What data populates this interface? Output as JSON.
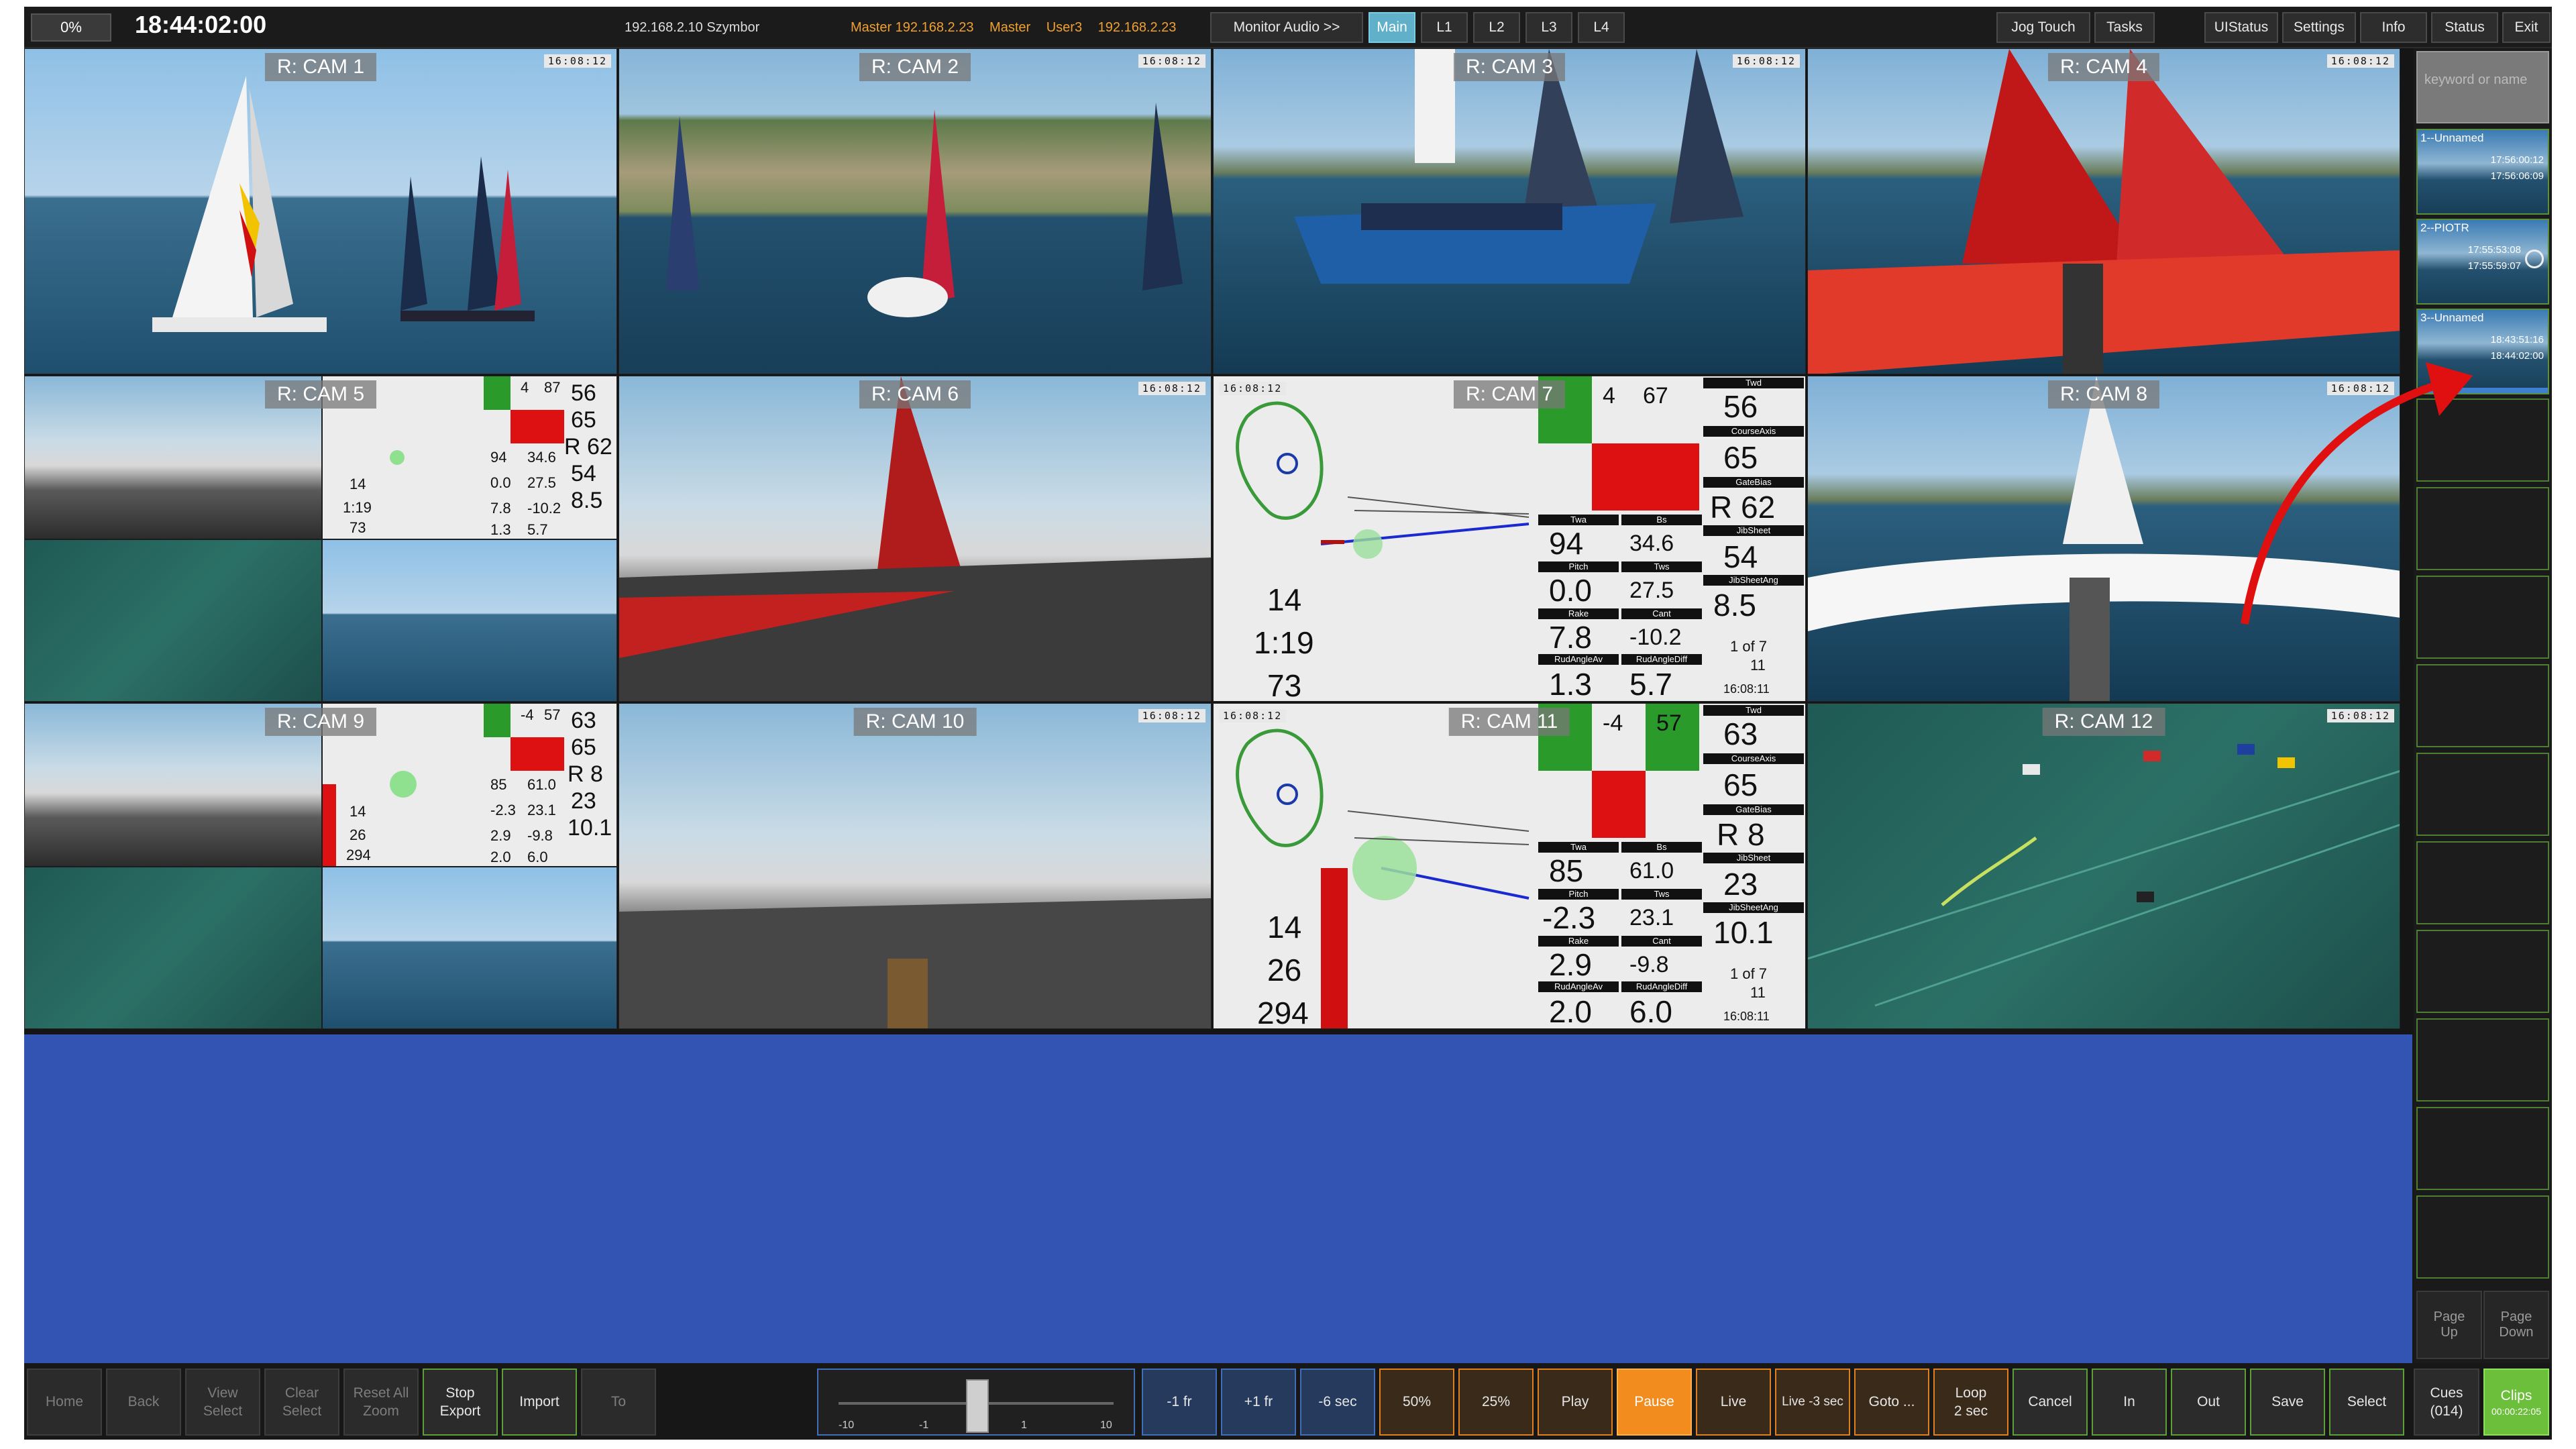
{
  "topbar": {
    "percent": "0%",
    "clock": "18:44:02:00",
    "ip": "192.168.2.10 Szymbor",
    "master_parts": [
      "Master 192.168.2.23",
      "Master",
      "User3",
      "192.168.2.23"
    ],
    "buttons": {
      "monitor_audio": "Monitor Audio >>",
      "main": "Main",
      "l1": "L1",
      "l2": "L2",
      "l3": "L3",
      "l4": "L4",
      "jog_touch": "Jog Touch",
      "tasks": "Tasks",
      "uistatus": "UIStatus",
      "settings": "Settings",
      "info": "Info",
      "status": "Status",
      "exit": "Exit"
    }
  },
  "cameras": [
    {
      "label": "R: CAM 1",
      "tc": "16:08:12"
    },
    {
      "label": "R: CAM 2",
      "tc": "16:08:12"
    },
    {
      "label": "R: CAM 3",
      "tc": "16:08:12"
    },
    {
      "label": "R: CAM 4",
      "tc": "16:08:12"
    },
    {
      "label": "R: CAM 5",
      "tc": ""
    },
    {
      "label": "R: CAM 6",
      "tc": "16:08:12"
    },
    {
      "label": "R: CAM 7",
      "tc": "16:08:12"
    },
    {
      "label": "R: CAM 8",
      "tc": "16:08:12"
    },
    {
      "label": "R: CAM 9",
      "tc": ""
    },
    {
      "label": "R: CAM 10",
      "tc": "16:08:12"
    },
    {
      "label": "R: CAM 11",
      "tc": "16:08:12"
    },
    {
      "label": "R: CAM 12",
      "tc": "16:08:12"
    }
  ],
  "cam7": {
    "top": [
      "4",
      "67"
    ],
    "twd_lbl": "Twd",
    "twd": "56",
    "courseaxis_lbl": "CourseAxis",
    "courseaxis": "65",
    "gatebias_lbl": "GateBias",
    "gatebias": "R 62",
    "jibsheet_lbl": "JibSheet",
    "jibsheet": "54",
    "jibsheetang_lbl": "JibSheetAng",
    "jibsheetang": "8.5",
    "twa_lbl": "Twa",
    "twa": "94",
    "bs_lbl": "Bs",
    "bs": "34.6",
    "pitch_lbl": "Pitch",
    "pitch": "0.0",
    "tws_lbl": "Tws",
    "tws": "27.5",
    "rake_lbl": "Rake",
    "rake": "7.8",
    "cant_lbl": "Cant",
    "cant": "-10.2",
    "rudav_lbl": "RudAngleAv",
    "rudav": "1.3",
    "ruddiff_lbl": "RudAngleDiff",
    "ruddiff": "5.7",
    "legof": "1 of 7",
    "leg": "11",
    "time": "16:08:11",
    "left": [
      "14",
      "1:19",
      "73"
    ]
  },
  "cam11": {
    "top": [
      "-4",
      "57"
    ],
    "twd_lbl": "Twd",
    "twd": "63",
    "courseaxis_lbl": "CourseAxis",
    "courseaxis": "65",
    "gatebias_lbl": "GateBias",
    "gatebias": "R 8",
    "jibsheet_lbl": "JibSheet",
    "jibsheet": "23",
    "jibsheetang_lbl": "JibSheetAng",
    "jibsheetang": "10.1",
    "twa_lbl": "Twa",
    "twa": "85",
    "bs_lbl": "Bs",
    "bs": "61.0",
    "pitch_lbl": "Pitch",
    "pitch": "-2.3",
    "tws_lbl": "Tws",
    "tws": "23.1",
    "rake_lbl": "Rake",
    "rake": "2.9",
    "cant_lbl": "Cant",
    "cant": "-9.8",
    "rudav_lbl": "RudAngleAv",
    "rudav": "2.0",
    "ruddiff_lbl": "RudAngleDiff",
    "ruddiff": "6.0",
    "legof": "1 of 7",
    "leg": "11",
    "time": "16:08:11",
    "left": [
      "14",
      "26",
      "294"
    ]
  },
  "cam5_small": {
    "top": [
      "4",
      "87"
    ],
    "vals": [
      "56",
      "65",
      "R 62",
      "54",
      "8.5"
    ],
    "row": [
      "94",
      "34.6",
      "0.0",
      "27.5",
      "7.8",
      "-10.2",
      "1.3",
      "5.7"
    ],
    "left": [
      "14",
      "1:19",
      "73"
    ]
  },
  "cam9_small": {
    "top": [
      "-4",
      "57"
    ],
    "vals": [
      "63",
      "65",
      "R 8",
      "23",
      "10.1"
    ],
    "row": [
      "85",
      "61.0",
      "-2.3",
      "23.1",
      "2.9",
      "-9.8",
      "2.0",
      "6.0"
    ],
    "left": [
      "14",
      "26",
      "294"
    ]
  },
  "sidebar": {
    "search_placeholder": "keyword or name",
    "clips": [
      {
        "name": "1--Unnamed",
        "t1": "17:56:00:12",
        "t2": "17:56:06:09"
      },
      {
        "name": "2--PIOTR",
        "t1": "17:55:53:08",
        "t2": "17:55:59:07"
      },
      {
        "name": "3--Unnamed",
        "t1": "18:43:51:16",
        "t2": "18:44:02:00"
      }
    ],
    "page_up": "Page\nUp",
    "page_down": "Page\nDown"
  },
  "bottom": {
    "home": "Home",
    "back": "Back",
    "view_select": "View\nSelect",
    "clear_select": "Clear\nSelect",
    "reset_zoom": "Reset All\nZoom",
    "stop_export": "Stop\nExport",
    "import": "Import",
    "to": "To",
    "jog_labels": [
      "-10",
      "-1",
      "1",
      "10"
    ],
    "minus_1fr": "-1 fr",
    "plus_1fr": "+1 fr",
    "minus_6sec": "-6 sec",
    "p50": "50%",
    "p25": "25%",
    "play": "Play",
    "pause": "Pause",
    "live": "Live",
    "live_minus3": "Live -3 sec",
    "goto": "Goto ...",
    "loop": "Loop\n2 sec",
    "cancel": "Cancel",
    "in": "In",
    "out": "Out",
    "save": "Save",
    "select": "Select",
    "cues": "Cues\n(014)",
    "clips": "Clips",
    "clips_time": "00:00:22:05"
  },
  "colors": {
    "accent_orange": "#f28c1e",
    "accent_green": "#6bbf3a",
    "blue_area": "#3454b4",
    "annotation_arrow": "#e01010"
  }
}
